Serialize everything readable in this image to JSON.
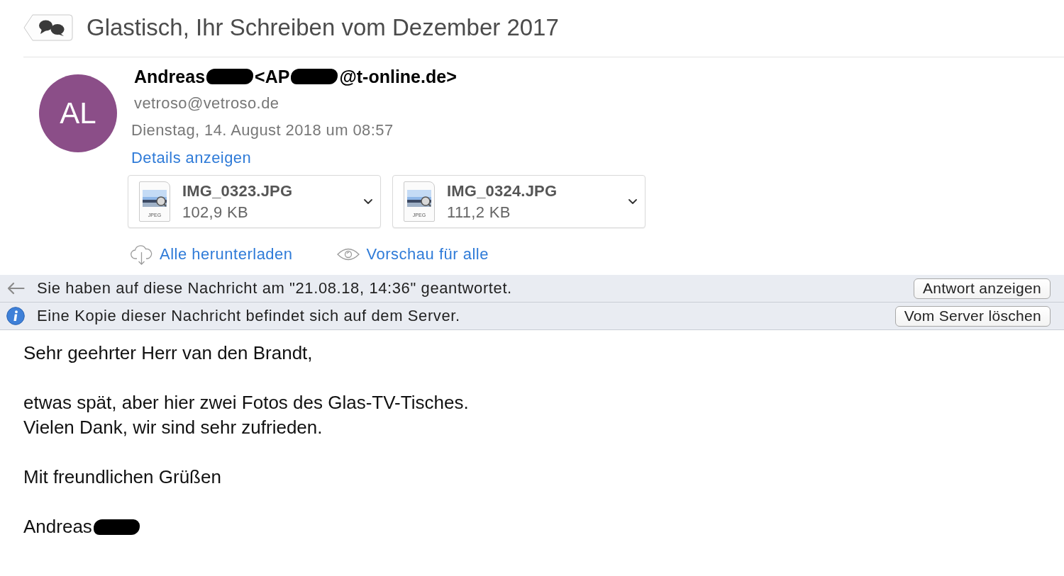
{
  "conversation": {
    "title": "Glastisch, Ihr Schreiben vom Dezember 2017"
  },
  "message": {
    "avatar": {
      "initials": "AL"
    },
    "from": [
      {
        "kind": "text",
        "text": "Andreas"
      },
      {
        "kind": "redacted"
      },
      {
        "kind": "text",
        "text": "<AP"
      },
      {
        "kind": "redacted"
      },
      {
        "kind": "text",
        "text": "@t-online.de>"
      }
    ],
    "to": "vetroso@vetroso.de",
    "date": "Dienstag, 14. August 2018 um 08:57",
    "details_link": "Details anzeigen",
    "attachments": [
      {
        "name": "IMG_0323.JPG",
        "size": "102,9 KB",
        "file_type": "JPEG"
      },
      {
        "name": "IMG_0324.JPG",
        "size": "111,2 KB",
        "file_type": "JPEG"
      }
    ],
    "attachment_actions": [
      {
        "kind": "download",
        "label": "Alle herunterladen"
      },
      {
        "kind": "preview",
        "label": "Vorschau für alle"
      }
    ],
    "notices": [
      {
        "kind": "replied",
        "text": "Sie haben auf diese Nachricht am \"21.08.18, 14:36\" geantwortet.",
        "button": "Antwort anzeigen"
      },
      {
        "kind": "info",
        "text": "Eine Kopie dieser Nachricht befindet sich auf dem Server.",
        "button": "Vom Server löschen"
      }
    ],
    "body": {
      "paragraphs": [
        {
          "lines": [
            "Sehr geehrter Herr van den Brandt,"
          ]
        },
        {
          "lines": [
            "etwas spät, aber hier zwei Fotos des Glas-TV-Tisches.",
            "Vielen Dank, wir sind sehr zufrieden."
          ]
        },
        {
          "lines": [
            "Mit freundlichen Grüßen"
          ]
        }
      ],
      "signature": [
        {
          "kind": "text",
          "text": "Andreas"
        },
        {
          "kind": "redacted"
        }
      ]
    }
  }
}
